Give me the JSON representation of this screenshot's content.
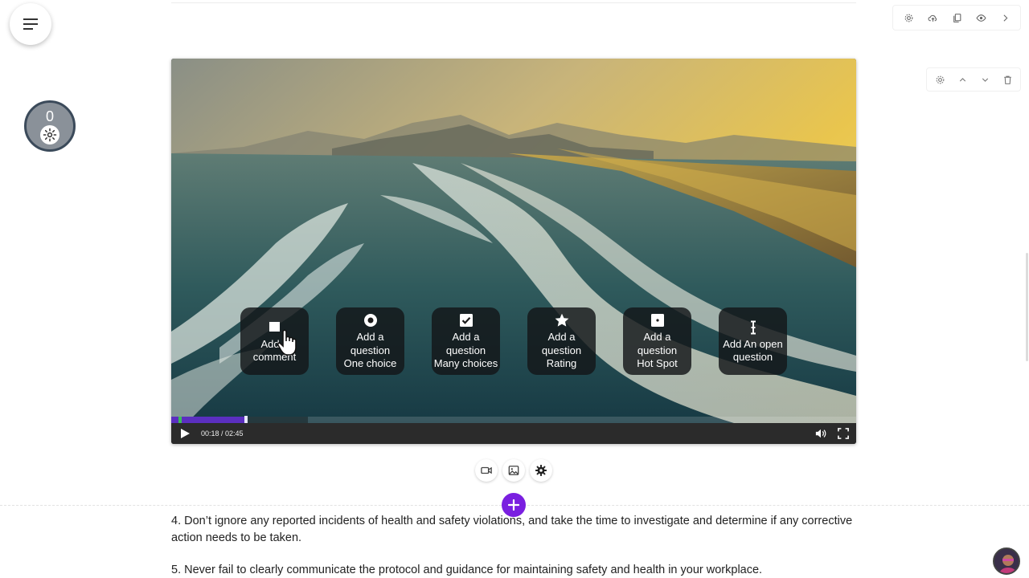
{
  "counter": {
    "value": "0"
  },
  "video": {
    "time": "00:18 / 02:45",
    "progress_fraction": 0.109,
    "buffered_fraction": 0.2,
    "question_buttons": [
      {
        "icon": "comment-icon",
        "lines": [
          "Add a",
          "comment"
        ]
      },
      {
        "icon": "radio-icon",
        "lines": [
          "Add a",
          "question",
          "One choice"
        ]
      },
      {
        "icon": "checkbox-icon",
        "lines": [
          "Add a",
          "question",
          "Many choices"
        ]
      },
      {
        "icon": "star-icon",
        "lines": [
          "Add a",
          "question",
          "Rating"
        ]
      },
      {
        "icon": "hotspot-icon",
        "lines": [
          "Add a",
          "question",
          "Hot Spot"
        ]
      },
      {
        "icon": "text-cursor-icon",
        "lines": [
          "Add An open",
          "question"
        ]
      }
    ]
  },
  "content": {
    "paragraph_4": "4. Don’t ignore any reported incidents of health and safety violations, and take the time to investigate and determine if any corrective action needs to be taken.",
    "paragraph_5": "5. Never fail to clearly communicate the protocol and guidance for maintaining safety and health in your workplace."
  },
  "colors": {
    "accent_purple": "#7a1fe0",
    "progress_purple": "#5b2fc0",
    "marker_green": "#3bbd5a"
  }
}
